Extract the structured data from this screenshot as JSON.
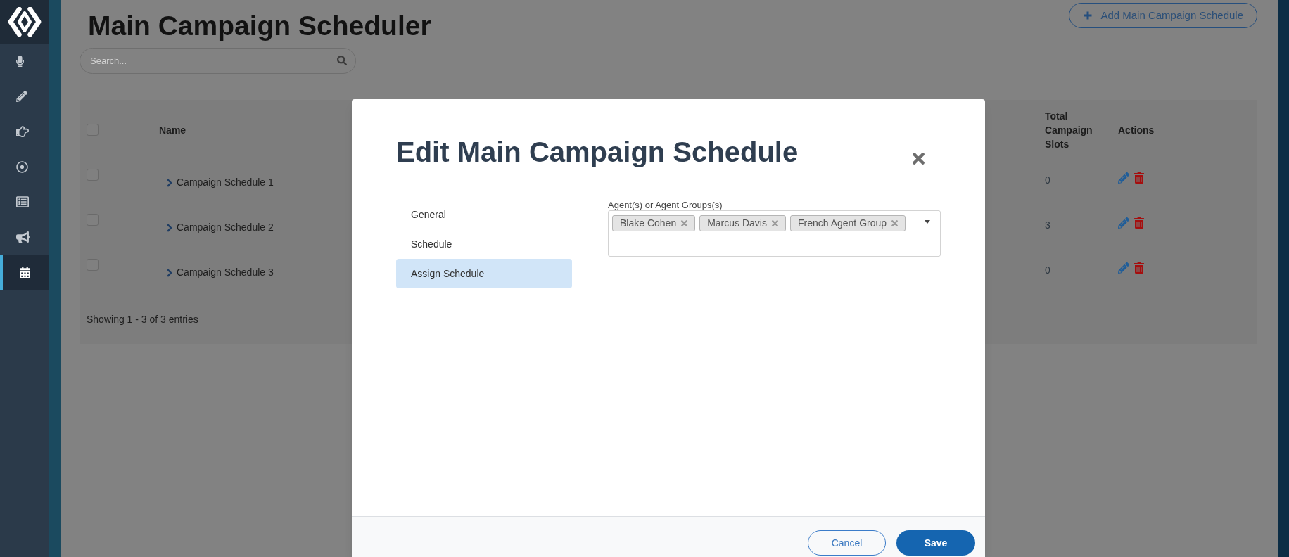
{
  "sidebar": {
    "items": [
      {
        "selected": false
      },
      {
        "selected": false
      },
      {
        "selected": false
      },
      {
        "selected": false
      },
      {
        "selected": false
      },
      {
        "selected": false
      },
      {
        "selected": true
      }
    ]
  },
  "page": {
    "title": "Main Campaign Scheduler",
    "add_button": "Add Main Campaign Schedule",
    "search": {
      "placeholder": "Search..."
    }
  },
  "table": {
    "header_checkbox": {
      "checked": false
    },
    "columns": [
      "Name",
      "Total Campaign Slots",
      "Actions"
    ],
    "rows": [
      {
        "checked": false,
        "expanded": false,
        "name": "Campaign Schedule 1",
        "total_campaign_slots": "0"
      },
      {
        "checked": false,
        "expanded": false,
        "name": "Campaign Schedule 2",
        "total_campaign_slots": "3"
      },
      {
        "checked": false,
        "expanded": false,
        "name": "Campaign Schedule 3",
        "total_campaign_slots": "0"
      }
    ],
    "footer": "Showing 1 - 3 of 3 entries"
  },
  "modal": {
    "title": "Edit Main Campaign Schedule",
    "nav": [
      {
        "label": "General",
        "selected": false
      },
      {
        "label": "Schedule",
        "selected": false
      },
      {
        "label": "Assign Schedule",
        "selected": true
      }
    ],
    "agents_field": {
      "label": "Agent(s) or Agent Groups(s)",
      "tags": [
        "Blake Cohen",
        "Marcus Davis",
        "French Agent Group"
      ]
    },
    "buttons": [
      {
        "kind": "secondary",
        "label": "Cancel"
      },
      {
        "kind": "primary",
        "label": "Save"
      }
    ]
  }
}
